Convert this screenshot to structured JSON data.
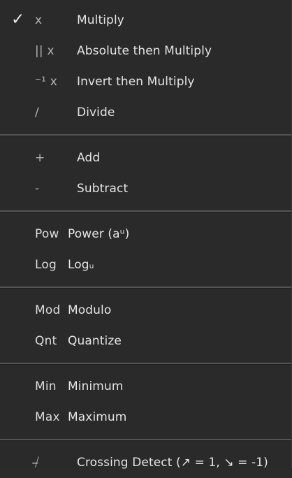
{
  "menu": {
    "groups": [
      {
        "items": [
          {
            "checked": "✓",
            "symbol": "x",
            "label": "Multiply"
          },
          {
            "symbol": "|| x",
            "label": "Absolute then Multiply"
          },
          {
            "symbol": "⁻¹ x",
            "label": "Invert then Multiply"
          },
          {
            "symbol": "/",
            "label": "Divide"
          }
        ]
      },
      {
        "items": [
          {
            "symbol": "+",
            "label": "Add"
          },
          {
            "symbol": "-",
            "label": "Subtract"
          }
        ]
      },
      {
        "items": [
          {
            "symbol": "Pow",
            "label": "Power (aᵘ)"
          },
          {
            "symbol": "Log",
            "label": "Logᵤ"
          }
        ]
      },
      {
        "items": [
          {
            "symbol": "Mod",
            "label": "Modulo"
          },
          {
            "symbol": "Qnt",
            "label": "Quantize"
          }
        ]
      },
      {
        "items": [
          {
            "symbol": "Min",
            "label": "Minimum"
          },
          {
            "symbol": "Max",
            "label": "Maximum"
          }
        ]
      },
      {
        "items": [
          {
            "symbol": "⧸̶",
            "label": "Crossing Detect (↗ = 1, ↘ = -1)"
          }
        ]
      }
    ]
  }
}
